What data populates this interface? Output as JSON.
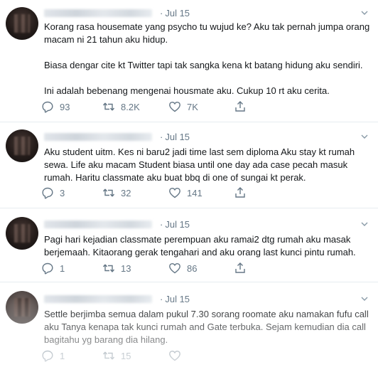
{
  "tweets": [
    {
      "timestamp": "Jul 15",
      "text": "Korang rasa housemate yang psycho tu wujud ke? Aku tak pernah jumpa orang macam ni 21 tahun aku hidup.\n\nBiasa dengar cite kt Twitter tapi tak sangka kena kt batang hidung aku sendiri.\n\nIni adalah bebenang mengenai housmate aku. Cukup 10 rt aku cerita.",
      "replies": "93",
      "retweets": "8.2K",
      "likes": "7K"
    },
    {
      "timestamp": "Jul 15",
      "text": "Aku student uitm. Kes ni baru2 jadi time last sem diploma Aku stay kt rumah sewa. Life aku macam Student biasa until one day ada case pecah masuk rumah. Haritu classmate aku buat bbq di one of sungai kt perak.",
      "replies": "3",
      "retweets": "32",
      "likes": "141"
    },
    {
      "timestamp": "Jul 15",
      "text": "Pagi hari kejadian classmate perempuan aku ramai2 dtg rumah aku masak berjemaah. Kitaorang gerak tengahari and aku orang last kunci pintu rumah.",
      "replies": "1",
      "retweets": "13",
      "likes": "86"
    },
    {
      "timestamp": "Jul 15",
      "text": "Settle berjimba semua dalam pukul 7.30 sorang roomate  aku namakan fufu call aku Tanya kenapa tak kunci rumah and Gate terbuka. Sejam kemudian dia call bagitahu yg barang dia hilang.",
      "replies": "1",
      "retweets": "15",
      "likes": ""
    }
  ],
  "separator": "·",
  "icons": [
    "reply-icon",
    "retweet-icon",
    "like-icon",
    "share-icon",
    "caret-down-icon"
  ],
  "colors": {
    "text": "#14171a",
    "muted": "#657786",
    "divider": "#e6ecf0"
  }
}
